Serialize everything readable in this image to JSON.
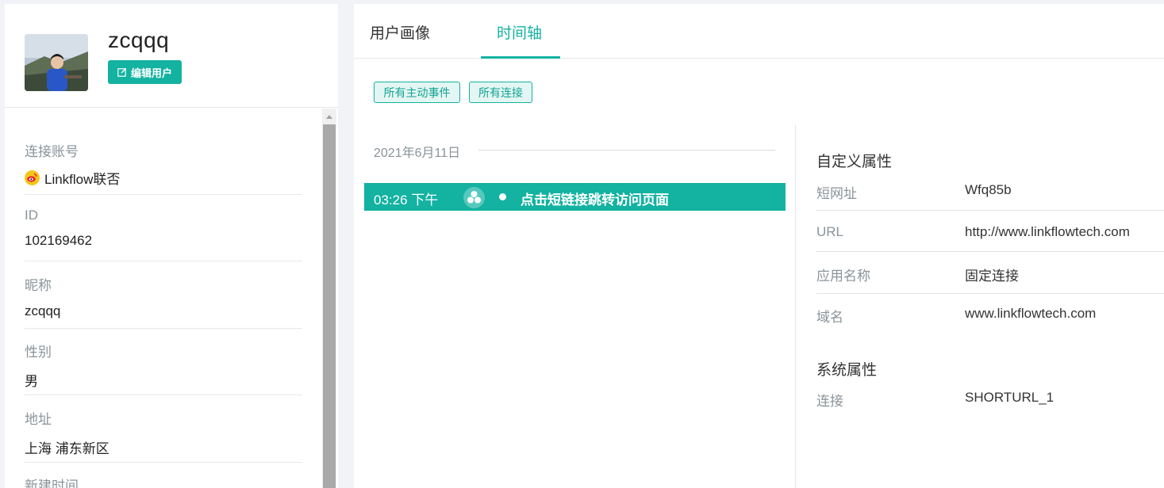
{
  "profile": {
    "username": "zcqqq",
    "edit_button": "编辑用户"
  },
  "info_fields": [
    {
      "label": "连接账号",
      "value": "Linkflow联否",
      "icon": "weibo-icon"
    },
    {
      "label": "ID",
      "value": "102169462"
    },
    {
      "label": "昵称",
      "value": "zcqqq"
    },
    {
      "label": "性别",
      "value": "男"
    },
    {
      "label": "地址",
      "value": "上海 浦东新区"
    },
    {
      "label": "新建时间",
      "value": ""
    }
  ],
  "tabs": [
    {
      "label": "用户画像",
      "active": false
    },
    {
      "label": "时间轴",
      "active": true
    }
  ],
  "filters": [
    "所有主动事件",
    "所有连接"
  ],
  "timeline": {
    "date": "2021年6月11日",
    "events": [
      {
        "time": "03:26 下午",
        "icon": "link-cluster-icon",
        "text": "点击短链接跳转访问页面"
      }
    ]
  },
  "custom_properties": {
    "title": "自定义属性",
    "rows": [
      {
        "key": "短网址",
        "value": "Wfq85b"
      },
      {
        "key": "URL",
        "value": "http://www.linkflowtech.com"
      },
      {
        "key": "应用名称",
        "value": "固定连接"
      },
      {
        "key": "域名",
        "value": "www.linkflowtech.com"
      }
    ]
  },
  "system_properties": {
    "title": "系统属性",
    "rows": [
      {
        "key": "连接",
        "value": "SHORTURL_1"
      }
    ]
  },
  "colors": {
    "accent": "#13b2a1",
    "background": "#f2f3f7",
    "muted_text": "#8a9399"
  }
}
